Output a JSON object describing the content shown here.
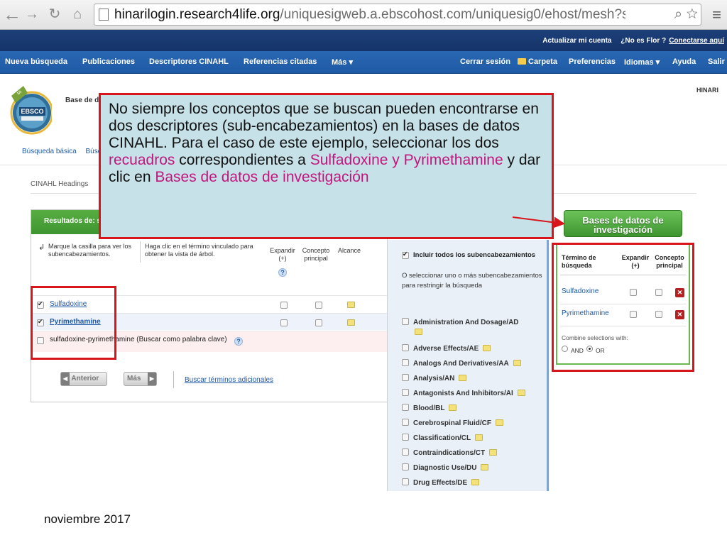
{
  "browser": {
    "url_host": "hinarilogin.research4life.org",
    "url_path": "/uniquesigweb.a.ebscohost.com/uniquesig0/ehost/mesh?sid=b5c83..."
  },
  "topbar": {
    "update_account": "Actualizar mi cuenta",
    "not_user": "¿No es Flor ?",
    "login_here": "Conectarse aquí"
  },
  "mainnav": {
    "new_search": "Nueva búsqueda",
    "publications": "Publicaciones",
    "cinahl_descriptors": "Descriptores CINAHL",
    "cited_refs": "Referencias citadas",
    "more": "Más ▾",
    "sign_out": "Cerrar sesión",
    "folder": "Carpeta",
    "preferences": "Preferencias",
    "languages": "Idiomas ▾",
    "help": "Ayuda",
    "exit": "Salir"
  },
  "header": {
    "logo_text": "EBSCO",
    "db_label": "Base de d",
    "hinari": "HINARI",
    "basic_search": "Búsqueda básica",
    "other_search": "Búsq",
    "headings_title": "CINAHL Headings"
  },
  "results": {
    "title": "Resultados de: s",
    "instr_1": "Marque la casilla para ver los subencabezamientos.",
    "instr_2": "Haga clic en el término vinculado para obtener la vista de árbol.",
    "col_explode": "Expandir (+)",
    "col_major": "Concepto principal",
    "col_scope": "Alcance",
    "help": "?",
    "rows": [
      {
        "label": "Sulfadoxine",
        "checked": true
      },
      {
        "label": "Pyrimethamine",
        "checked": true
      },
      {
        "label": "sulfadoxine-pyrimethamine (Buscar como palabra clave)",
        "checked": false
      }
    ],
    "prev": "Anterior",
    "next": "Más",
    "more_terms": "Buscar términos adicionales"
  },
  "subheadings": {
    "include_all": "Incluir todos los subencabezamientos",
    "note": "O seleccionar uno o más subencabezamientos para restringir la búsqueda",
    "items": [
      "Administration And Dosage/AD",
      "Adverse Effects/AE",
      "Analogs And Derivatives/AA",
      "Analysis/AN",
      "Antagonists And Inhibitors/AI",
      "Blood/BL",
      "Cerebrospinal Fluid/CF",
      "Classification/CL",
      "Contraindications/CT",
      "Diagnostic Use/DU",
      "Drug Effects/DE"
    ]
  },
  "right_panel": {
    "search_db_button": "Bases de datos de investigación",
    "col_term": "Término de búsqueda",
    "col_explode": "Expandir (+)",
    "col_major": "Concepto principal",
    "terms": [
      "Sulfadoxine",
      "Pyrimethamine"
    ],
    "combine_label": "Combine selections with:",
    "and": "AND",
    "or": "OR"
  },
  "callout": {
    "p1": "No siempre los conceptos que se buscan pueden encontrarse en dos descriptores (sub-encabezamientos) en la bases de datos CINAHL. Para el caso de este ejemplo, seleccionar los dos ",
    "h1": "recuadros",
    "p2": " correspondientes a ",
    "h2": "Sulfadoxine y Pyrimethamine",
    "p3": " y dar clic en ",
    "h3": "Bases de datos de investigación"
  },
  "footer": {
    "date": "noviembre 2017"
  },
  "colors": {
    "nav_blue": "#1e5aa5",
    "top_blue": "#143369",
    "green": "#3e9530",
    "highlight_red": "#d7151b",
    "callout_bg": "#c7e1e8",
    "highlight_pink": "#c2167d"
  }
}
